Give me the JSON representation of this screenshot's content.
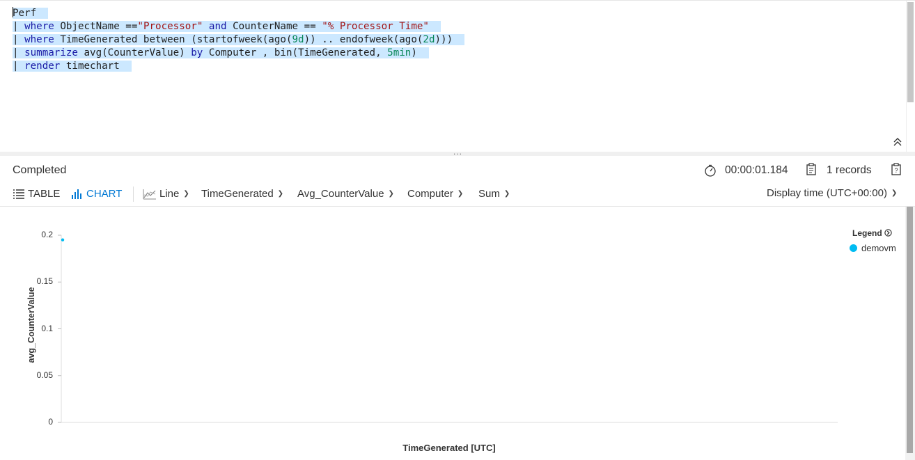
{
  "editor": {
    "lines": [
      [
        {
          "t": "Perf",
          "c": "plain"
        }
      ],
      [
        {
          "t": "| ",
          "c": "plain"
        },
        {
          "t": "where",
          "c": "kw"
        },
        {
          "t": " ObjectName ==",
          "c": "plain"
        },
        {
          "t": "\"Processor\"",
          "c": "str"
        },
        {
          "t": " ",
          "c": "plain"
        },
        {
          "t": "and",
          "c": "kw"
        },
        {
          "t": " CounterName == ",
          "c": "plain"
        },
        {
          "t": "\"% Processor Time\"",
          "c": "str"
        }
      ],
      [
        {
          "t": "| ",
          "c": "plain"
        },
        {
          "t": "where",
          "c": "kw"
        },
        {
          "t": " TimeGenerated between (startofweek(ago(",
          "c": "plain"
        },
        {
          "t": "9d",
          "c": "num"
        },
        {
          "t": ")) .. endofweek(ago(",
          "c": "plain"
        },
        {
          "t": "2d",
          "c": "num"
        },
        {
          "t": ")))",
          "c": "plain"
        }
      ],
      [
        {
          "t": "| ",
          "c": "plain"
        },
        {
          "t": "summarize",
          "c": "kw"
        },
        {
          "t": " avg(CounterValue) ",
          "c": "plain"
        },
        {
          "t": "by",
          "c": "kw"
        },
        {
          "t": " Computer , bin(TimeGenerated, ",
          "c": "plain"
        },
        {
          "t": "5min",
          "c": "num"
        },
        {
          "t": ")",
          "c": "plain"
        }
      ],
      [
        {
          "t": "| ",
          "c": "plain"
        },
        {
          "t": "render",
          "c": "kw"
        },
        {
          "t": " timechart",
          "c": "plain"
        }
      ]
    ]
  },
  "splitter": {
    "dots": "..."
  },
  "status": {
    "text": "Completed",
    "elapsed": "00:00:01.184",
    "records": "1 records"
  },
  "toolbar": {
    "table_label": "TABLE",
    "chart_label": "CHART",
    "chart_type": "Line",
    "x_column": "TimeGenerated",
    "y_column": "Avg_CounterValue",
    "split_column": "Computer",
    "aggregation": "Sum",
    "display_time": "Display time (UTC+00:00)"
  },
  "colors": {
    "accent": "#0078d4",
    "series": "#00bcf2"
  },
  "chart_data": {
    "type": "line",
    "xlabel": "TimeGenerated [UTC]",
    "ylabel": "avg_CounterValue",
    "ylim": [
      0,
      0.2
    ],
    "yticks": [
      "0.2",
      "0.15",
      "0.1",
      "0.05",
      "0"
    ],
    "legend_title": "Legend",
    "legend_position": "top-right",
    "series": [
      {
        "name": "demovm",
        "values": [
          0.195
        ]
      }
    ]
  }
}
